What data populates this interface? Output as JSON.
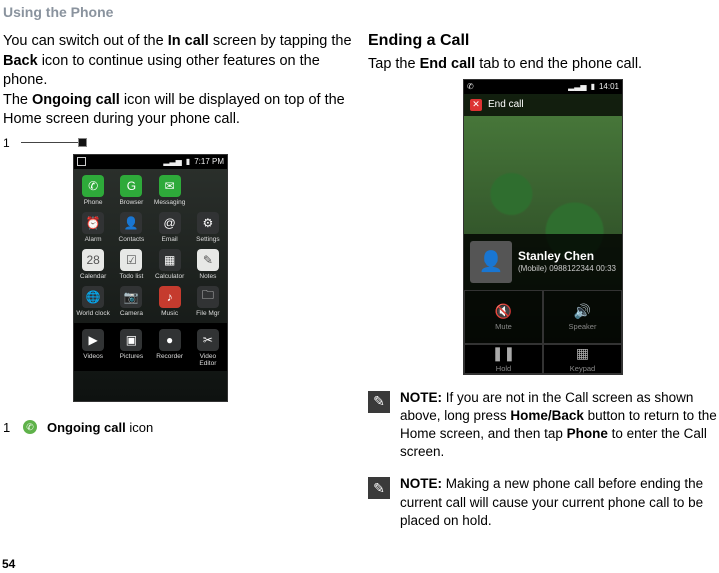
{
  "page": {
    "section_title": "Using the Phone",
    "page_number": "54"
  },
  "left": {
    "p1_a": "You can switch out of the ",
    "p1_b": "In call",
    "p1_c": " screen by tapping the ",
    "p1_d": "Back",
    "p1_e": " icon to continue using other features on the phone.",
    "p2_a": "The ",
    "p2_b": "Ongoing call",
    "p2_c": " icon will be displayed on top of the Home screen during your phone call.",
    "callout_num": "1",
    "legend_num": "1",
    "legend_label_bold": "Ongoing call",
    "legend_label_rest": " icon"
  },
  "left_phone": {
    "time": "7:17 PM",
    "rows": [
      [
        "Phone",
        "Browser",
        "Messaging",
        ""
      ],
      [
        "Alarm",
        "Contacts",
        "Email",
        "Settings"
      ],
      [
        "Calendar",
        "Todo list",
        "Calculator",
        "Notes"
      ],
      [
        "World clock",
        "Camera",
        "Music",
        "File Mgr"
      ],
      [
        "Videos",
        "Pictures",
        "Recorder",
        "Video Editor"
      ]
    ]
  },
  "right": {
    "heading": "Ending a Call",
    "p1_a": "Tap the ",
    "p1_b": "End call",
    "p1_c": " tab to end the phone call."
  },
  "right_phone": {
    "time": "14:01",
    "endcall_label": "End call",
    "caller_name": "Stanley Chen",
    "caller_type": "(Mobile)",
    "caller_number": "0988122344",
    "duration": "00:33",
    "btn_mute": "Mute",
    "btn_speaker": "Speaker",
    "btn_hold": "Hold",
    "btn_keypad": "Keypad"
  },
  "notes": {
    "n1_a": "NOTE:",
    "n1_b": " If you are not in the Call screen as shown above, long press ",
    "n1_c": "Home/Back",
    "n1_d": " button to return to the Home screen, and then tap ",
    "n1_e": "Phone",
    "n1_f": " to enter the Call screen.",
    "n2_a": "NOTE:",
    "n2_b": " Making a new phone call before ending the current call will cause your current phone call to be placed on hold."
  }
}
